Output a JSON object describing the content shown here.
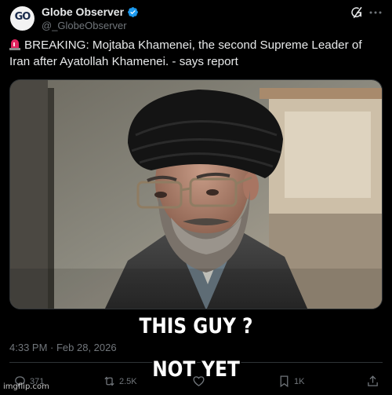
{
  "account": {
    "display_name": "Globe Observer",
    "handle": "@_GlobeObserver",
    "avatar_text": "GO",
    "avatar_icon": "globe-observer-logo"
  },
  "post": {
    "text": "BREAKING: Mojtaba Khamenei, the second Supreme Leader of Iran after Ayatollah Khamenei. - says report",
    "leading_icon": "siren-emoji",
    "timestamp": "4:33 PM · Feb 28, 2026"
  },
  "actions": {
    "replies": "371",
    "reposts": "2.5K",
    "likes": "",
    "bookmarks": "1K"
  },
  "meme": {
    "caption_line1": "THIS GUY ?",
    "caption_line2": "NOT YET",
    "watermark": "imgflip.com"
  },
  "colors": {
    "background": "#000000",
    "text_primary": "#e7e9ea",
    "text_secondary": "#71767b",
    "verified_blue": "#1d9bf0",
    "divider": "#2f3336"
  }
}
